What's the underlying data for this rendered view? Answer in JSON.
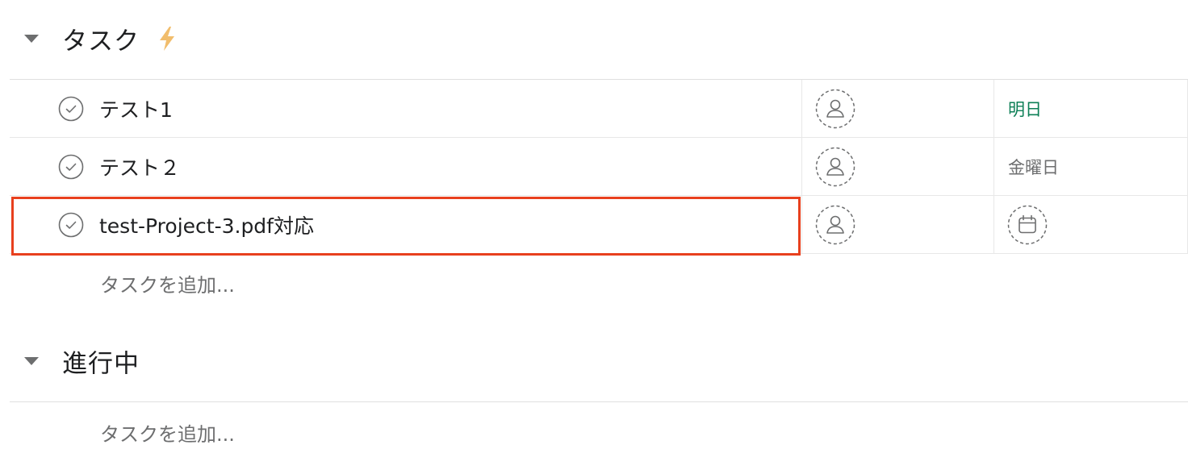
{
  "sections": [
    {
      "title": "タスク",
      "add_task_label": "タスクを追加...",
      "tasks": [
        {
          "name": "テスト1",
          "due": "明日",
          "due_color": "#0d7f56"
        },
        {
          "name": "テスト２",
          "due": "金曜日",
          "due_color": "#6d6e6f"
        },
        {
          "name": "test-Project-3.pdf対応",
          "due": "",
          "selected": true
        }
      ]
    },
    {
      "title": "進行中",
      "add_task_label": "タスクを追加..."
    }
  ],
  "icons": {
    "collapse": "caret-down-icon",
    "rule": "lightning-bolt-icon",
    "complete": "check-circle-icon",
    "assignee": "person-placeholder-icon",
    "due_date": "calendar-icon"
  },
  "colors": {
    "highlight": "#e8401e",
    "bolt": "#f1bd6c"
  }
}
